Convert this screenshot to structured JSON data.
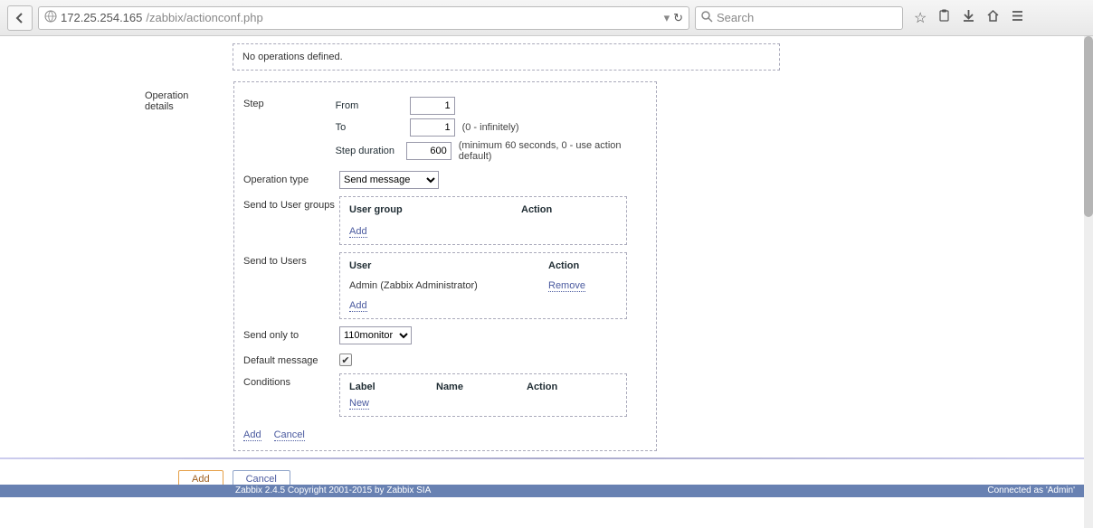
{
  "browser": {
    "url_host": "172.25.254.165",
    "url_path": "/zabbix/actionconf.php",
    "search_placeholder": "Search"
  },
  "no_ops": "No operations defined.",
  "section_label": "Operation details",
  "step": {
    "label": "Step",
    "from_label": "From",
    "from_value": "1",
    "to_label": "To",
    "to_value": "1",
    "to_hint": "(0 - infinitely)",
    "duration_label": "Step duration",
    "duration_value": "600",
    "duration_hint": "(minimum 60 seconds, 0 - use action default)"
  },
  "op_type": {
    "label": "Operation type",
    "value": "Send message"
  },
  "user_groups": {
    "label": "Send to User groups",
    "col1": "User group",
    "col2": "Action",
    "add_link": "Add"
  },
  "users": {
    "label": "Send to Users",
    "col1": "User",
    "col2": "Action",
    "row_user": "Admin (Zabbix Administrator)",
    "row_action": "Remove",
    "add_link": "Add"
  },
  "send_only": {
    "label": "Send only to",
    "value": "110monitor"
  },
  "default_msg": {
    "label": "Default message",
    "checked": true
  },
  "conditions": {
    "label": "Conditions",
    "col1": "Label",
    "col2": "Name",
    "col3": "Action",
    "new_link": "New"
  },
  "box_actions": {
    "add": "Add",
    "cancel": "Cancel"
  },
  "page_buttons": {
    "add": "Add",
    "cancel": "Cancel"
  },
  "footer": {
    "copyright": "Zabbix 2.4.5 Copyright 2001-2015 by Zabbix SIA",
    "connected": "Connected as 'Admin'"
  }
}
